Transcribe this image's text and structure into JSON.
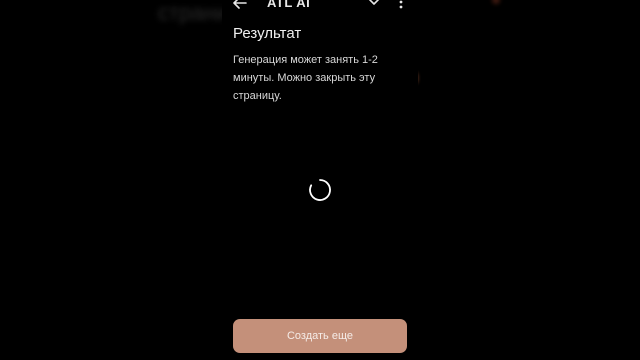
{
  "background": {
    "blurred_text": "страни"
  },
  "header": {
    "back_icon": "arrow-left-icon",
    "title": "ATL AI",
    "dropdown_icon": "chevron-down-icon",
    "more_icon": "more-vertical-icon"
  },
  "content": {
    "heading": "Результат",
    "description": "Генерация может занять 1-2 минуты. Можно закрыть эту страницу.",
    "loading_icon": "spinner-icon"
  },
  "actions": {
    "create_more_label": "Создать еще"
  },
  "colors": {
    "accent": "#c4907a",
    "background": "#000000",
    "text": "#f0f0f0"
  }
}
